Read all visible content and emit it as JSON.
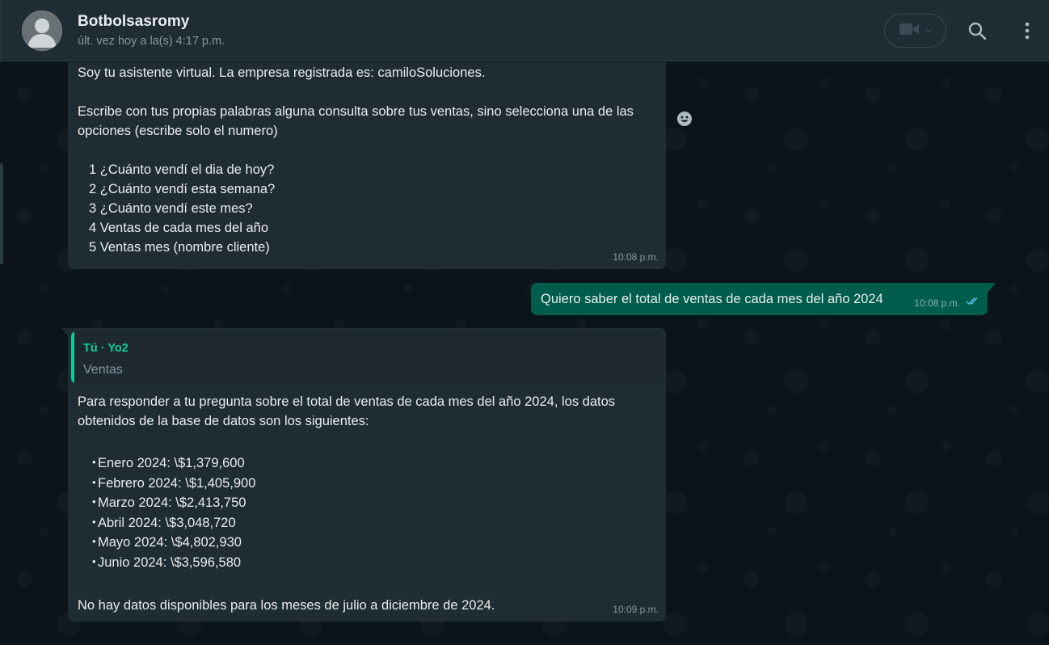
{
  "header": {
    "contact_name": "Botbolsasromy",
    "last_seen": "últ. vez hoy a la(s) 4:17 p.m.",
    "icons": [
      "video-call-icon",
      "chevron-down-icon",
      "search-icon",
      "menu-icon"
    ]
  },
  "messages": {
    "bot_welcome": {
      "paragraphs": [
        "Soy tu asistente virtual. La empresa registrada es: camiloSoluciones.",
        "",
        "Escribe con tus propias palabras alguna consulta sobre tus ventas, sino selecciona una de las opciones (escribe solo el numero)",
        ""
      ],
      "options": [
        "1 ¿Cuánto vendí el dia de hoy?",
        "2 ¿Cuánto vendí esta semana?",
        "3 ¿Cuánto vendí este mes?",
        "4 Ventas de cada mes del año",
        "5 Ventas mes (nombre cliente)"
      ],
      "time": "10:08 p.m."
    },
    "user_query": {
      "text": "Quiero saber el total de ventas de cada mes del año 2024",
      "time": "10:08 p.m."
    },
    "bot_answer": {
      "quote_author": "Tú · Yo2",
      "quote_text": "Ventas",
      "intro": "Para responder a tu pregunta sobre el total de ventas de cada mes del año 2024, los datos obtenidos de la base de datos son los siguientes:",
      "bullets": [
        "Enero 2024: \\$1,379,600",
        "Febrero 2024: \\$1,405,900",
        "Marzo 2024: \\$2,413,750",
        "Abril 2024: \\$3,048,720",
        "Mayo 2024: \\$4,802,930",
        "Junio 2024: \\$3,596,580"
      ],
      "outro": "No hay datos disponibles para los meses de julio a diciembre de 2024.",
      "time": "10:09 p.m."
    }
  },
  "colors": {
    "chat_bg": "#0b141a",
    "header_bg": "#202c33",
    "incoming_bubble": "#202c33",
    "outgoing_bubble": "#005c4b",
    "accent": "#06cf9c",
    "read_ticks": "#53bdeb"
  }
}
